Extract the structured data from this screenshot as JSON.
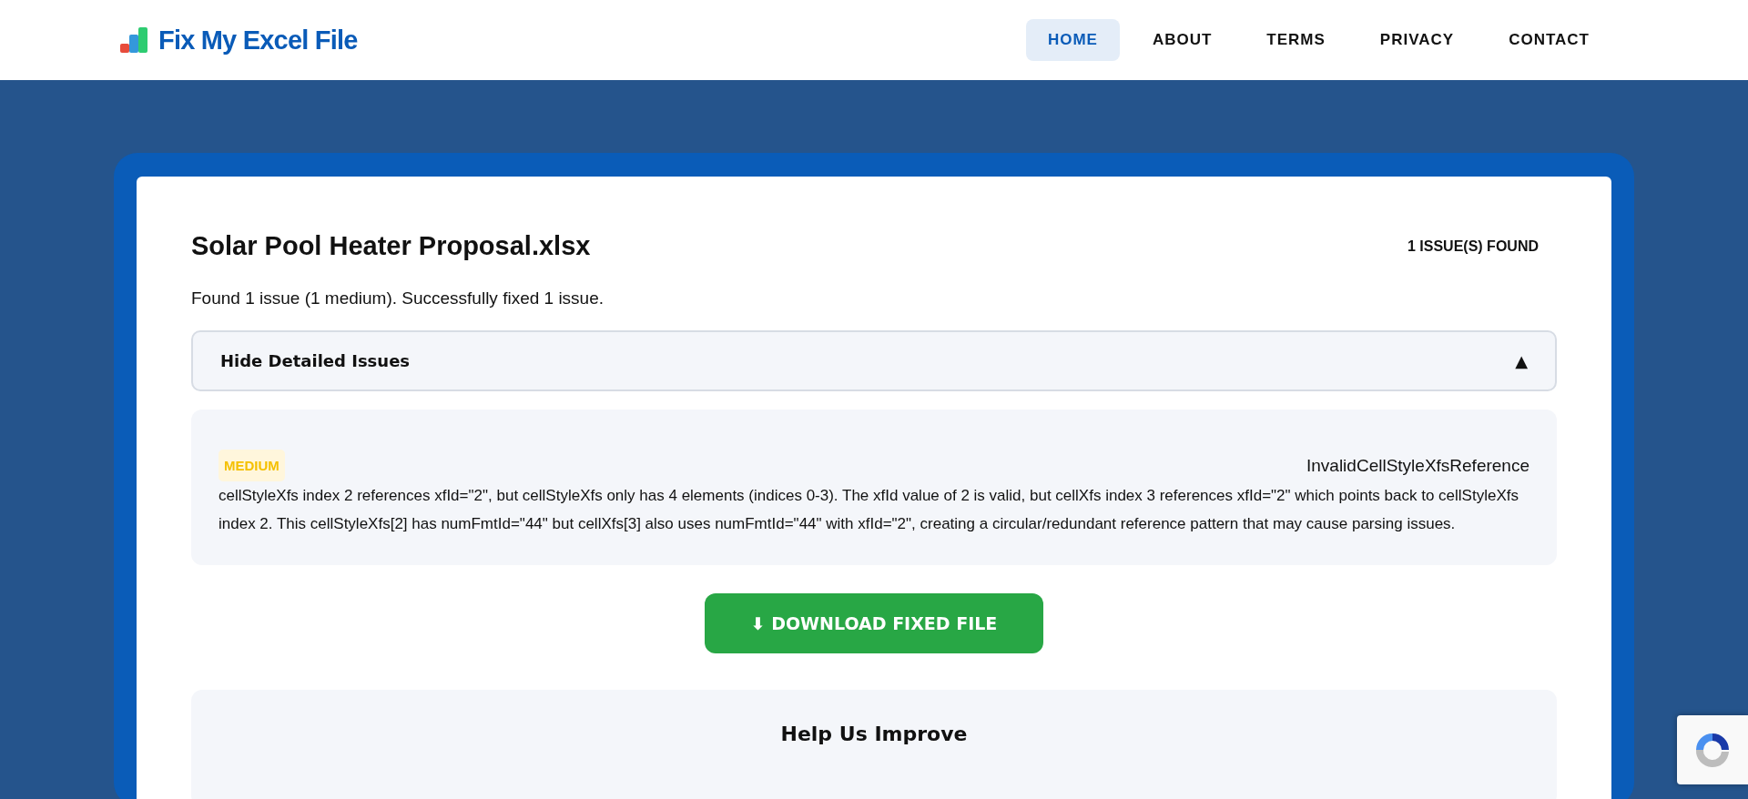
{
  "header": {
    "logo": "Fix My Excel File",
    "nav": [
      {
        "label": "HOME",
        "selected": true
      },
      {
        "label": "ABOUT",
        "selected": false
      },
      {
        "label": "TERMS",
        "selected": false
      },
      {
        "label": "PRIVACY",
        "selected": false
      },
      {
        "label": "CONTACT",
        "selected": false
      }
    ]
  },
  "report": {
    "filename": "Solar Pool Heater Proposal.xlsx",
    "issue_count": "1 ISSUE(S) FOUND",
    "summary": "Found 1 issue (1 medium). Successfully fixed 1 issue.",
    "toggle": {
      "label": "Hide Detailed Issues",
      "icon": "▲",
      "expanded": true
    },
    "issues": [
      {
        "severity": "MEDIUM",
        "code": "InvalidCellStyleXfsReference",
        "description": "cellStyleXfs index 2 references xfId=\"2\", but cellStyleXfs only has 4 elements (indices 0-3). The xfId value of 2 is valid, but cellXfs index 3 references xfId=\"2\" which points back to cellStyleXfs index 2. This cellStyleXfs[2] has numFmtId=\"44\" but cellXfs[3] also uses numFmtId=\"44\" with xfId=\"2\", creating a circular/redundant reference pattern that may cause parsing issues."
      }
    ],
    "download_button": "⬇ DOWNLOAD FIXED FILE"
  },
  "feedback": {
    "heading": "Help Us Improve"
  }
}
